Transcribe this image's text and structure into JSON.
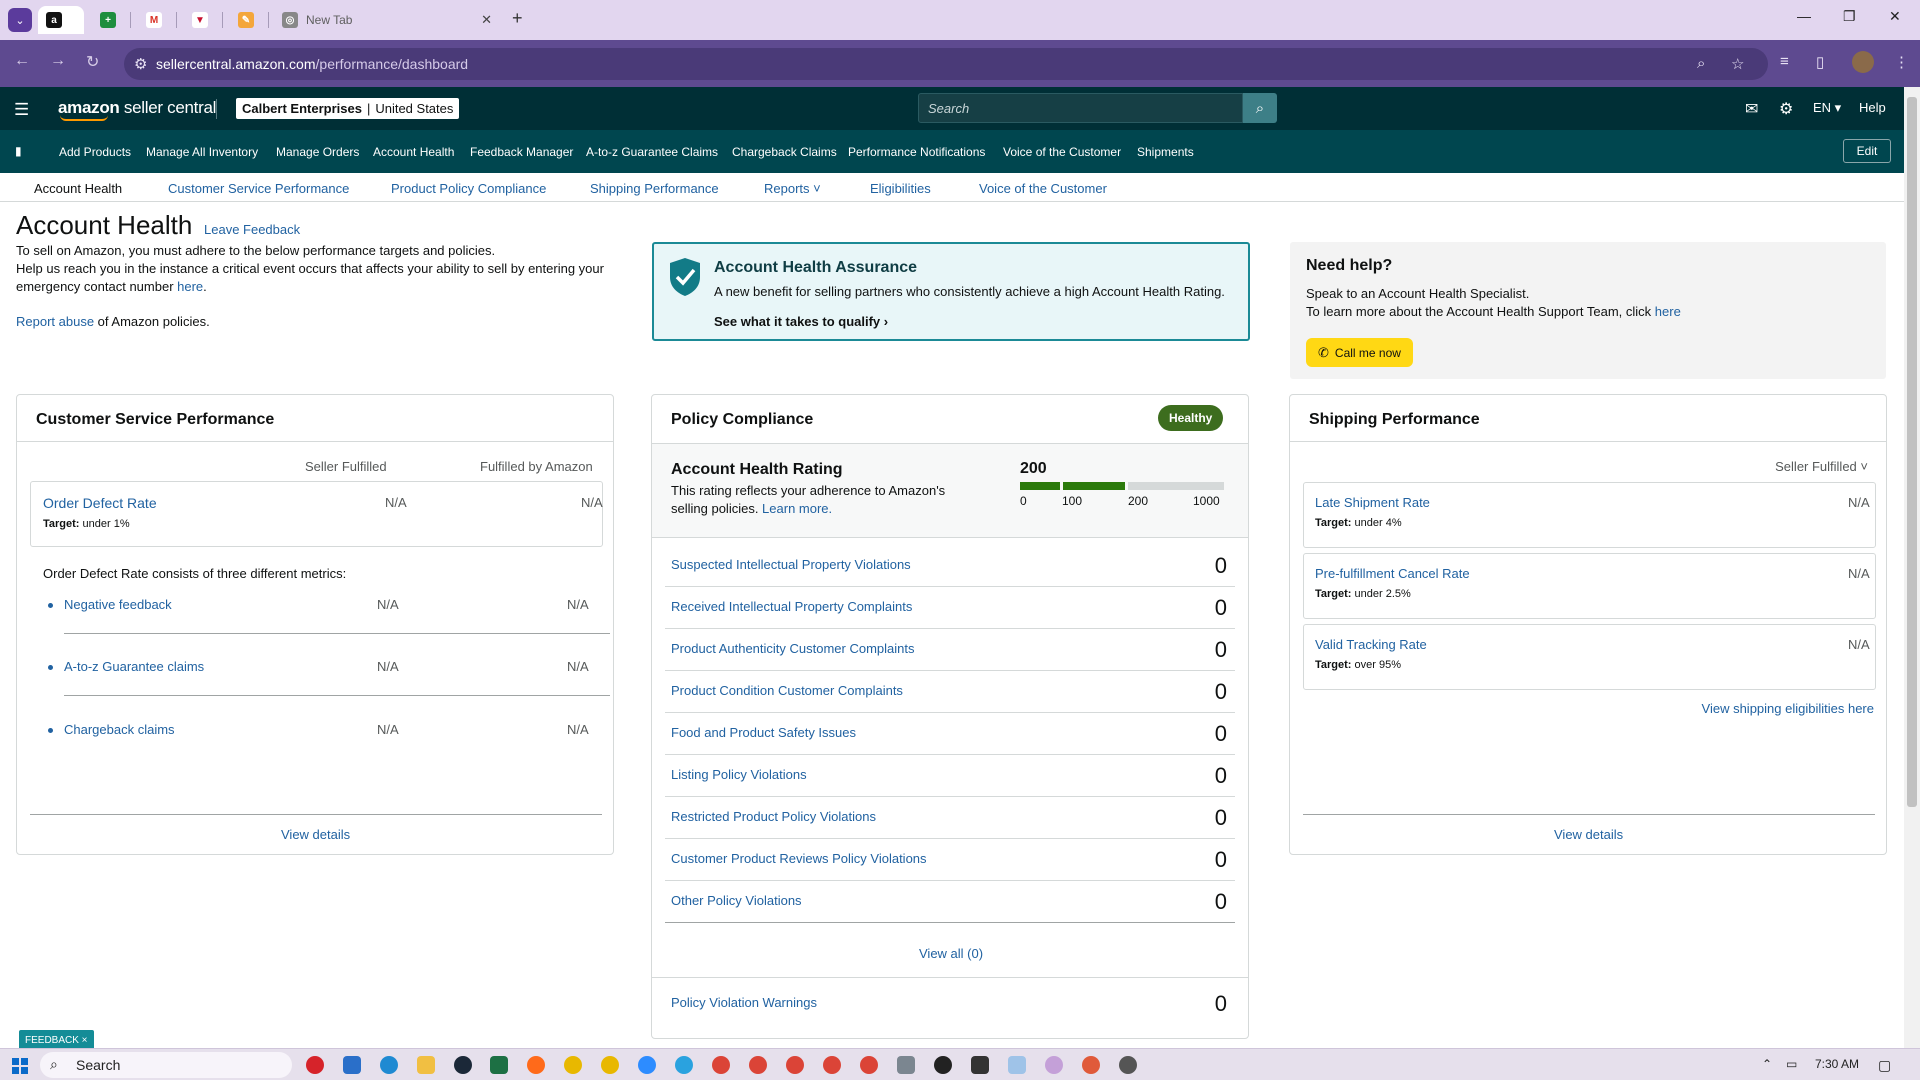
{
  "browser": {
    "tabs": [
      {
        "icon": "amazon-icon",
        "title": ""
      },
      {
        "icon": "sheets-icon",
        "title": ""
      },
      {
        "icon": "gmail-icon",
        "title": ""
      },
      {
        "icon": "red-v-icon",
        "title": ""
      },
      {
        "icon": "tool-icon",
        "title": ""
      },
      {
        "icon": "chrome-icon",
        "title": "New Tab"
      }
    ],
    "url_host": "sellercentral.amazon.com",
    "url_path": "/performance/dashboard"
  },
  "header": {
    "logo_bold": "amazon",
    "logo_rest": " seller central",
    "store_name": "Calbert Enterprises",
    "store_sep": "|",
    "store_country": "United States",
    "search_placeholder": "Search",
    "lang": "EN ▾",
    "help": "Help"
  },
  "bookmarks": {
    "items": [
      "Add Products",
      "Manage All Inventory",
      "Manage Orders",
      "Account Health",
      "Feedback Manager",
      "A-to-z Guarantee Claims",
      "Chargeback Claims",
      "Performance Notifications",
      "Voice of the Customer",
      "Shipments"
    ],
    "edit": "Edit"
  },
  "subnav": {
    "items": [
      "Account Health",
      "Customer Service Performance",
      "Product Policy Compliance",
      "Shipping Performance",
      "Reports ˅",
      "Eligibilities",
      "Voice of the Customer"
    ]
  },
  "page": {
    "title": "Account Health",
    "leave_feedback": "Leave Feedback",
    "intro_1": "To sell on Amazon, you must adhere to the below performance targets and policies.",
    "intro_2": "Help us reach you in the instance a critical event occurs that affects your ability to sell by entering your emergency contact number ",
    "intro_link": "here",
    "intro_end": ".",
    "report_link": "Report abuse",
    "report_rest": " of Amazon policies."
  },
  "assurance": {
    "title": "Account Health Assurance",
    "desc": "A new benefit for selling partners who consistently achieve a high Account Health Rating.",
    "link": "See what it takes to qualify ›"
  },
  "needhelp": {
    "title": "Need help?",
    "line1": "Speak to an Account Health Specialist.",
    "line2": "To learn more about the Account Health Support Team, click ",
    "line2_link": "here",
    "call_button": "Call me now"
  },
  "csp": {
    "title": "Customer Service Performance",
    "col1": "Seller Fulfilled",
    "col2": "Fulfilled by Amazon",
    "odr": {
      "name": "Order Defect Rate",
      "target_label": "Target:",
      "target": " under 1%",
      "v1": "N/A",
      "v2": "N/A"
    },
    "consists": "Order Defect Rate consists of three different metrics:",
    "metrics": [
      {
        "name": "Negative feedback",
        "v1": "N/A",
        "v2": "N/A"
      },
      {
        "name": "A-to-z Guarantee claims",
        "v1": "N/A",
        "v2": "N/A"
      },
      {
        "name": "Chargeback claims",
        "v1": "N/A",
        "v2": "N/A"
      }
    ],
    "view_details": "View details"
  },
  "policy": {
    "title": "Policy Compliance",
    "badge": "Healthy",
    "ahr_title": "Account Health Rating",
    "ahr_desc": "This rating reflects your adherence to Amazon's selling policies. ",
    "ahr_learn": "Learn more.",
    "ahr_value": "200",
    "ahr_ticks": [
      "0",
      "100",
      "200",
      "1000"
    ],
    "rows": [
      {
        "label": "Suspected Intellectual Property Violations",
        "value": "0"
      },
      {
        "label": "Received Intellectual Property Complaints",
        "value": "0"
      },
      {
        "label": "Product Authenticity Customer Complaints",
        "value": "0"
      },
      {
        "label": "Product Condition Customer Complaints",
        "value": "0"
      },
      {
        "label": "Food and Product Safety Issues",
        "value": "0"
      },
      {
        "label": "Listing Policy Violations",
        "value": "0"
      },
      {
        "label": "Restricted Product Policy Violations",
        "value": "0"
      },
      {
        "label": "Customer Product Reviews Policy Violations",
        "value": "0"
      },
      {
        "label": "Other Policy Violations",
        "value": "0"
      }
    ],
    "view_all": "View all (0)",
    "warnings_label": "Policy Violation Warnings",
    "warnings_value": "0"
  },
  "shipping": {
    "title": "Shipping Performance",
    "filter": "Seller Fulfilled ˅",
    "metrics": [
      {
        "name": "Late Shipment Rate",
        "target_label": "Target:",
        "target": " under 4%",
        "value": "N/A"
      },
      {
        "name": "Pre-fulfillment Cancel Rate",
        "target_label": "Target:",
        "target": " under 2.5%",
        "value": "N/A"
      },
      {
        "name": "Valid Tracking Rate",
        "target_label": "Target:",
        "target": " over 95%",
        "value": "N/A"
      }
    ],
    "eligibilities_link": "View shipping eligibilities here",
    "view_details": "View details"
  },
  "feedback_tab": "FEEDBACK ×",
  "taskbar": {
    "search": "Search",
    "time": "7:30 AM"
  },
  "colors": {
    "nav_dark": "#002f36",
    "nav_teal": "#00464f",
    "link": "#2162a1",
    "healthy": "#3d6d1e",
    "rating_fill": "#2b7a0b",
    "call_button": "#ffd814"
  }
}
